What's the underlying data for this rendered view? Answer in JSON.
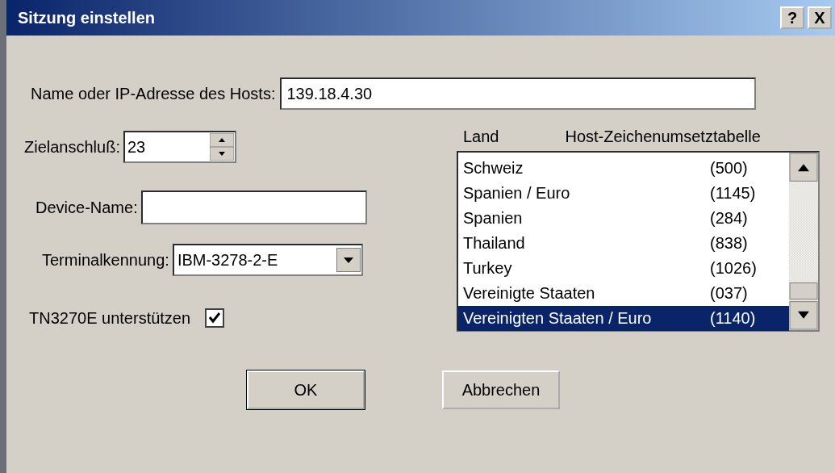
{
  "window": {
    "title": "Sitzung einstellen",
    "help_button": "?",
    "close_button": "X"
  },
  "host": {
    "label": "Name oder IP-Adresse des Hosts:",
    "value": "139.18.4.30"
  },
  "port": {
    "label": "Zielanschluß:",
    "value": "23"
  },
  "device_name": {
    "label": "Device-Name:"
  },
  "terminal": {
    "label": "Terminalkennung:",
    "value": "IBM-3278-2-E"
  },
  "tn3270e": {
    "label": "TN3270E unterstützen",
    "checked": true
  },
  "code_table": {
    "columns": [
      "Land",
      "Host-Zeichenumsetztabelle"
    ],
    "rows": [
      {
        "country": "Schweiz",
        "code": "(500)",
        "selected": false
      },
      {
        "country": "Spanien / Euro",
        "code": "(1145)",
        "selected": false
      },
      {
        "country": "Spanien",
        "code": "(284)",
        "selected": false
      },
      {
        "country": "Thailand",
        "code": "(838)",
        "selected": false
      },
      {
        "country": "Turkey",
        "code": "(1026)",
        "selected": false
      },
      {
        "country": "Vereinigte Staaten",
        "code": "(037)",
        "selected": false
      },
      {
        "country": "Vereinigten Staaten / Euro",
        "code": "(1140)",
        "selected": true
      }
    ]
  },
  "buttons": [
    {
      "label": "OK",
      "kind": "default"
    },
    {
      "label": "Abbrechen",
      "kind": "normal"
    }
  ]
}
